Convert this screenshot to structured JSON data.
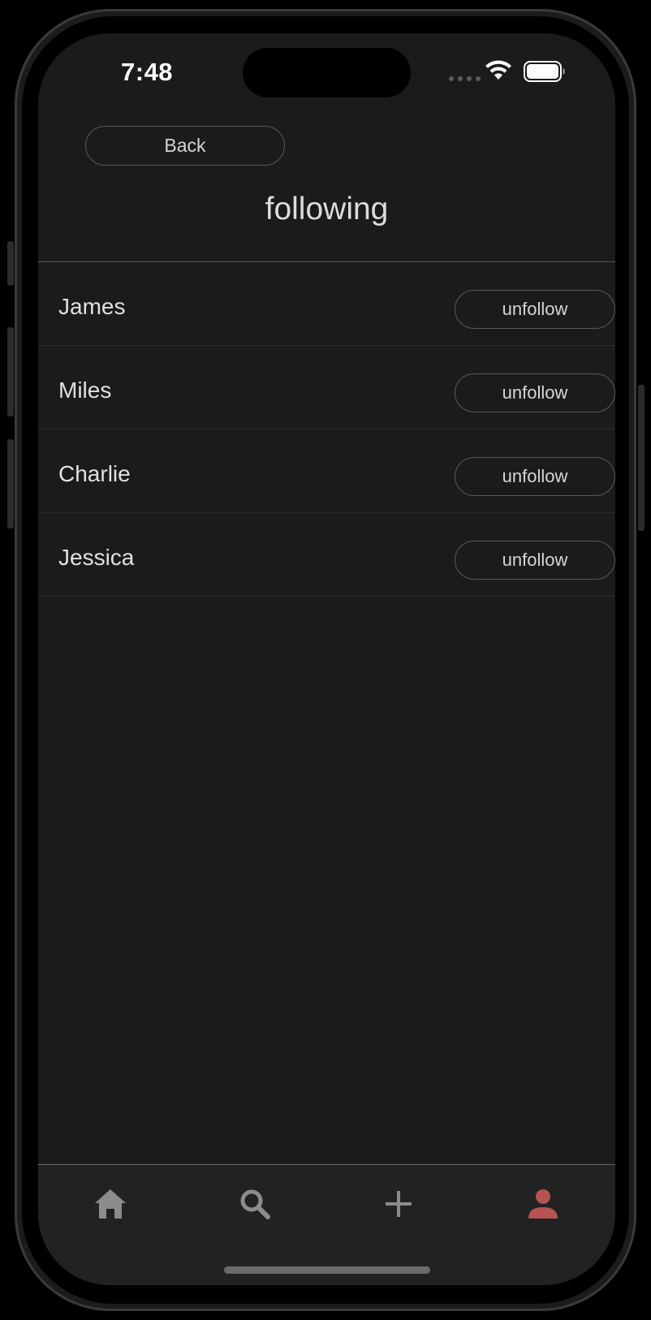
{
  "status_bar": {
    "time": "7:48"
  },
  "header": {
    "back_label": "Back",
    "title": "following"
  },
  "following": [
    {
      "name": "James",
      "action_label": "unfollow"
    },
    {
      "name": "Miles",
      "action_label": "unfollow"
    },
    {
      "name": "Charlie",
      "action_label": "unfollow"
    },
    {
      "name": "Jessica",
      "action_label": "unfollow"
    }
  ],
  "tab_bar": {
    "tabs": [
      {
        "icon": "home-icon",
        "active": false
      },
      {
        "icon": "search-icon",
        "active": false
      },
      {
        "icon": "plus-icon",
        "active": false
      },
      {
        "icon": "person-icon",
        "active": true
      }
    ],
    "active_color": "#b55353",
    "inactive_color": "#8c8c8c"
  }
}
